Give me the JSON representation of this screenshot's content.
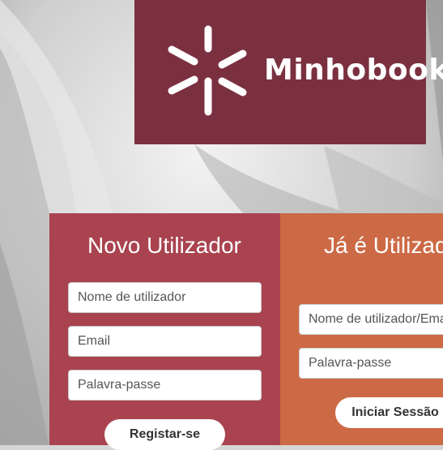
{
  "brand": {
    "name": "Minhobook",
    "logo_icon": "asterisk-logo-icon",
    "color": "#7b3040"
  },
  "signup": {
    "title": "Novo Utilizador",
    "username_placeholder": "Nome de utilizador",
    "email_placeholder": "Email",
    "password_placeholder": "Palavra-passe",
    "submit_label": "Registar-se",
    "color": "#a9434f"
  },
  "login": {
    "title": "Já é Utilizador?",
    "username_placeholder": "Nome de utilizador/Email",
    "password_placeholder": "Palavra-passe",
    "submit_label": "Iniciar Sessão",
    "color": "#cc6a45"
  }
}
